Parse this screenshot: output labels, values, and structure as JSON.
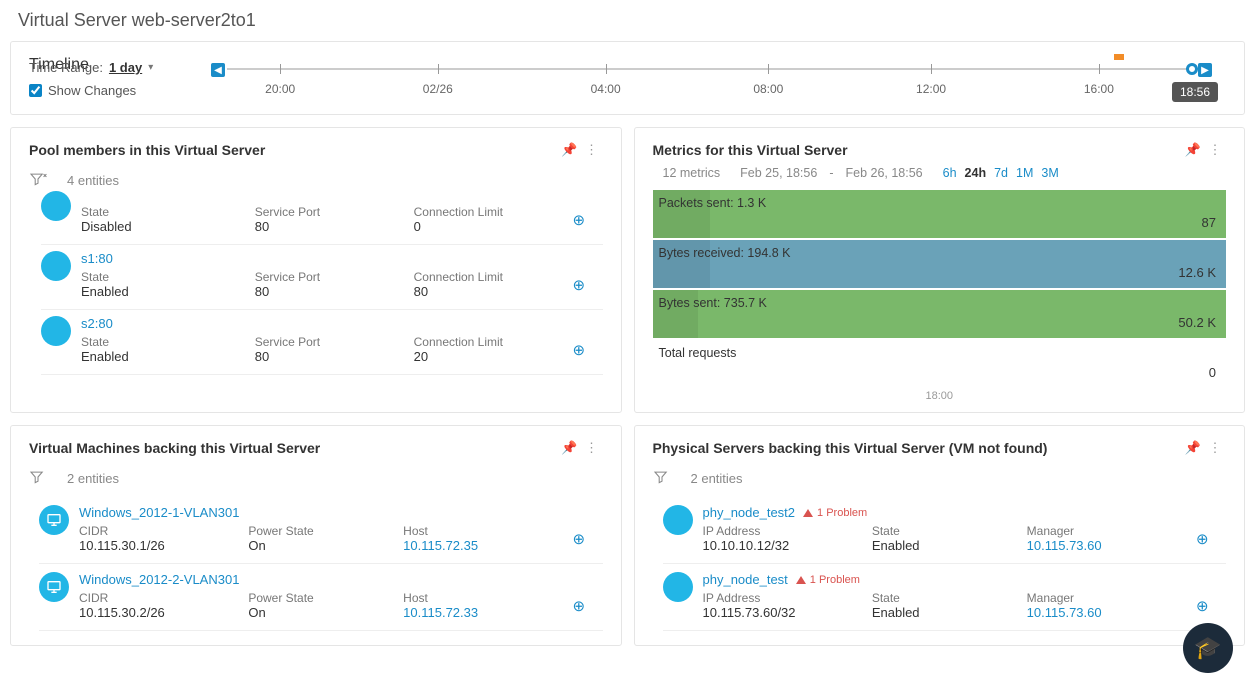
{
  "page_title": "Virtual Server web-server2to1",
  "timeline": {
    "title": "Timeline",
    "time_range_label": "Time Range:",
    "time_range_value": "1 day",
    "show_changes_label": "Show Changes",
    "show_changes_checked": true,
    "ticks": [
      "20:00",
      "02/26",
      "04:00",
      "08:00",
      "12:00",
      "16:00"
    ],
    "end_label": "18:56"
  },
  "pool": {
    "title": "Pool members in this Virtual Server",
    "entity_count": "4 entities",
    "items": [
      {
        "name": "",
        "state_label": "State",
        "state": "Disabled",
        "port_label": "Service Port",
        "port": "80",
        "limit_label": "Connection Limit",
        "limit": "0"
      },
      {
        "name": "s1:80",
        "state_label": "State",
        "state": "Enabled",
        "port_label": "Service Port",
        "port": "80",
        "limit_label": "Connection Limit",
        "limit": "80"
      },
      {
        "name": "s2:80",
        "state_label": "State",
        "state": "Enabled",
        "port_label": "Service Port",
        "port": "80",
        "limit_label": "Connection Limit",
        "limit": "20"
      }
    ]
  },
  "metrics": {
    "title": "Metrics for this Virtual Server",
    "count": "12 metrics",
    "date_from": "Feb 25, 18:56",
    "date_sep": "-",
    "date_to": "Feb 26, 18:56",
    "ranges": [
      "6h",
      "24h",
      "7d",
      "1M",
      "3M"
    ],
    "active_range": "24h",
    "rows": [
      {
        "label": "Packets sent: 1.3 K",
        "value": "87",
        "color": "green",
        "overlay_pct": 10
      },
      {
        "label": "Bytes received: 194.8 K",
        "value": "12.6 K",
        "color": "blue",
        "overlay_pct": 10
      },
      {
        "label": "Bytes sent: 735.7 K",
        "value": "50.2 K",
        "color": "green",
        "overlay_pct": 8
      },
      {
        "label": "Total requests",
        "value": "0",
        "color": "plain",
        "overlay_pct": 0
      }
    ],
    "footer_tick": "18:00"
  },
  "vms": {
    "title": "Virtual Machines backing this Virtual Server",
    "entity_count": "2 entities",
    "items": [
      {
        "name": "Windows_2012-1-VLAN301",
        "cidr_label": "CIDR",
        "cidr": "10.115.30.1/26",
        "power_label": "Power State",
        "power": "On",
        "host_label": "Host",
        "host": "10.115.72.35"
      },
      {
        "name": "Windows_2012-2-VLAN301",
        "cidr_label": "CIDR",
        "cidr": "10.115.30.2/26",
        "power_label": "Power State",
        "power": "On",
        "host_label": "Host",
        "host": "10.115.72.33"
      }
    ]
  },
  "phys": {
    "title": "Physical Servers backing this Virtual Server (VM not found)",
    "entity_count": "2 entities",
    "items": [
      {
        "name": "phy_node_test2",
        "problem": "1 Problem",
        "ip_label": "IP Address",
        "ip": "10.10.10.12/32",
        "state_label": "State",
        "state": "Enabled",
        "mgr_label": "Manager",
        "mgr": "10.115.73.60"
      },
      {
        "name": "phy_node_test",
        "problem": "1 Problem",
        "ip_label": "IP Address",
        "ip": "10.115.73.60/32",
        "state_label": "State",
        "state": "Enabled",
        "mgr_label": "Manager",
        "mgr": "10.115.73.60"
      }
    ]
  }
}
